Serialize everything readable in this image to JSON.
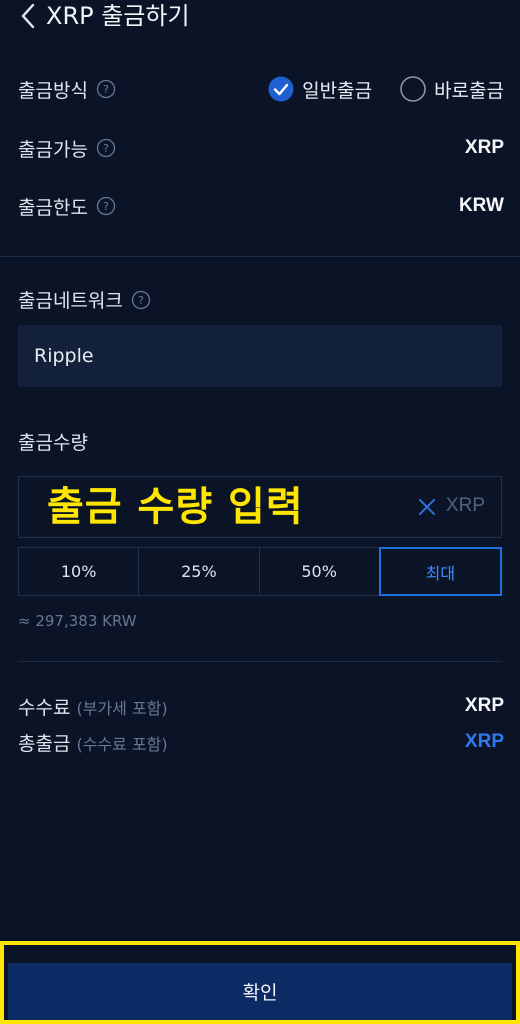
{
  "header": {
    "title": "XRP 출금하기"
  },
  "method": {
    "label": "출금방식",
    "options": [
      {
        "label": "일반출금",
        "selected": true
      },
      {
        "label": "바로출금",
        "selected": false
      }
    ]
  },
  "available": {
    "label": "출금가능",
    "value": "XRP"
  },
  "limit": {
    "label": "출금한도",
    "value": "KRW"
  },
  "network": {
    "label": "출금네트워크",
    "value": "Ripple"
  },
  "amount": {
    "label": "출금수량",
    "placeholder_overlay": "출금 수량 입력",
    "unit": "XRP",
    "percent_buttons": [
      "10%",
      "25%",
      "50%",
      "최대"
    ],
    "active_index": 3,
    "approx": "≈ 297,383 KRW"
  },
  "fee": {
    "label": "수수료",
    "sublabel": "(부가세 포함)",
    "value": "XRP"
  },
  "total": {
    "label": "총출금",
    "sublabel": "(수수료 포함)",
    "value": "XRP"
  },
  "confirm": {
    "label": "확인"
  },
  "colors": {
    "background": "#0a1426",
    "accent": "#2e7bf0",
    "highlight": "#ffe600",
    "button": "#0c2a63"
  }
}
